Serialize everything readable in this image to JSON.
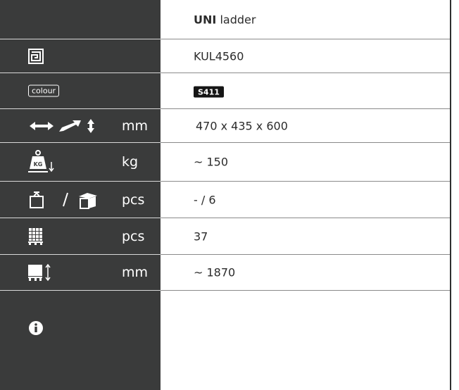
{
  "product": {
    "brand": "UNI",
    "name": "ladder",
    "code": "KUL4560",
    "colour_label": "colour",
    "colour_code": "S411",
    "dimensions": "470 x 435 x 600",
    "weight": "~ 150",
    "package_qty": "- / 6",
    "pallet_qty": "37",
    "pallet_height": "~ 1870"
  },
  "units": {
    "dimensions": "mm",
    "weight": "kg",
    "package": "pcs",
    "pallet": "pcs",
    "height": "mm"
  },
  "icons": {
    "code": "article-code-icon",
    "dimensions": "dimensions-arrows-icon",
    "weight": "weight-kg-icon",
    "package": "bag-and-box-icon",
    "pallet": "pallet-grid-icon",
    "pallet_height": "pallet-height-icon",
    "info": "info-icon"
  },
  "colors": {
    "panel_bg": "#3a3b3b",
    "badge_bg": "#151515",
    "text": "#2b2b2b"
  }
}
